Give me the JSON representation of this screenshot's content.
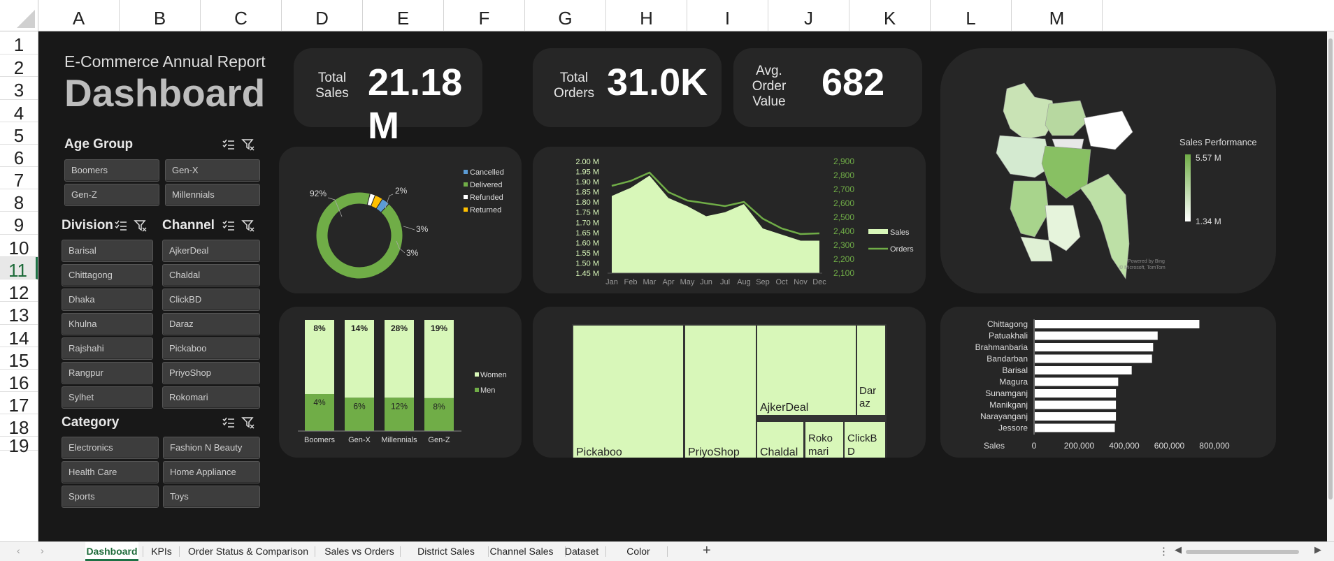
{
  "columns": [
    "A",
    "B",
    "C",
    "D",
    "E",
    "F",
    "G",
    "H",
    "I",
    "J",
    "K",
    "L",
    "M"
  ],
  "rows": [
    "1",
    "2",
    "3",
    "4",
    "5",
    "6",
    "7",
    "8",
    "9",
    "10",
    "11",
    "12",
    "13",
    "14",
    "15",
    "16",
    "17",
    "18",
    "19"
  ],
  "selected_row": "11",
  "header": {
    "subtitle": "E-Commerce Annual Report",
    "title": "Dashboard"
  },
  "kpis": [
    {
      "label": "Total\nSales",
      "value": "21.18 M"
    },
    {
      "label": "Total\nOrders",
      "value": "31.0K"
    },
    {
      "label": "Avg.\nOrder\nValue",
      "value": "682"
    }
  ],
  "slicers": {
    "age_group": {
      "title": "Age Group",
      "items": [
        "Boomers",
        "Gen-X",
        "Gen-Z",
        "Millennials"
      ]
    },
    "division": {
      "title": "Division",
      "items": [
        "Barisal",
        "Chittagong",
        "Dhaka",
        "Khulna",
        "Rajshahi",
        "Rangpur",
        "Sylhet"
      ]
    },
    "channel": {
      "title": "Channel",
      "items": [
        "AjkerDeal",
        "Chaldal",
        "ClickBD",
        "Daraz",
        "Pickaboo",
        "PriyoShop",
        "Rokomari"
      ]
    },
    "category": {
      "title": "Category",
      "items": [
        "Electronics",
        "Fashion N Beauty",
        "Health Care",
        "Home Appliance",
        "Sports",
        "Toys"
      ]
    }
  },
  "colors": {
    "green": "#70ad47",
    "light_green": "#d8f7b9",
    "blue": "#5b9bd5",
    "orange": "#ffc000",
    "card": "#262626",
    "bg": "#181818"
  },
  "chart_data": [
    {
      "type": "pie",
      "subtype": "donut",
      "legend": [
        "Cancelled",
        "Delivered",
        "Refunded",
        "Returned"
      ],
      "values": [
        3,
        92,
        2,
        3
      ],
      "data_labels": [
        "3%",
        "92%",
        "2%",
        "3%"
      ],
      "colors": [
        "#5b9bd5",
        "#70ad47",
        "#ffffff",
        "#ffc000"
      ]
    },
    {
      "type": "area",
      "categories": [
        "Jan",
        "Feb",
        "Mar",
        "Apr",
        "May",
        "Jun",
        "Jul",
        "Aug",
        "Sep",
        "Oct",
        "Nov",
        "Dec"
      ],
      "series": [
        {
          "name": "Sales",
          "axis": "left",
          "values": [
            1.83,
            1.87,
            1.93,
            1.82,
            1.78,
            1.73,
            1.75,
            1.79,
            1.67,
            1.64,
            1.61,
            1.61
          ]
        },
        {
          "name": "Orders",
          "axis": "right",
          "values": [
            2725,
            2760,
            2820,
            2680,
            2620,
            2600,
            2580,
            2610,
            2490,
            2420,
            2380,
            2385
          ]
        }
      ],
      "y_ticks": [
        "2.00 M",
        "1.95 M",
        "1.90 M",
        "1.85 M",
        "1.80 M",
        "1.75 M",
        "1.70 M",
        "1.65 M",
        "1.60 M",
        "1.55 M",
        "1.50 M",
        "1.45 M"
      ],
      "y_range": [
        1.45,
        2.0
      ],
      "y2_ticks": [
        "2,900",
        "2,800",
        "2,700",
        "2,600",
        "2,500",
        "2,400",
        "2,300",
        "2,200",
        "2,100"
      ],
      "y2_range": [
        2100,
        2900
      ],
      "legend_position": "right"
    },
    {
      "type": "map",
      "title": "Sales Performance",
      "legend_max": "5.57 M",
      "legend_min": "1.34 M",
      "attribution_1": "Powered by Bing",
      "attribution_2": "© Microsoft, TomTom"
    },
    {
      "type": "bar",
      "subtype": "stacked_100",
      "categories": [
        "Boomers",
        "Gen-X",
        "Millennials",
        "Gen-Z"
      ],
      "series": [
        {
          "name": "Women",
          "values": [
            8,
            14,
            28,
            19
          ],
          "labels": [
            "8%",
            "14%",
            "28%",
            "19%"
          ]
        },
        {
          "name": "Men",
          "values": [
            4,
            6,
            12,
            8
          ],
          "labels": [
            "4%",
            "6%",
            "12%",
            "8%"
          ]
        }
      ],
      "legend_position": "right"
    },
    {
      "type": "treemap",
      "items": [
        {
          "label": "Pickaboo"
        },
        {
          "label": "PriyoShop"
        },
        {
          "label": "AjkerDeal"
        },
        {
          "label": "Daraz"
        },
        {
          "label": "Chaldal"
        },
        {
          "label": "Rokomari"
        },
        {
          "label": "ClickBD"
        }
      ]
    },
    {
      "type": "bar",
      "orientation": "horizontal",
      "categories": [
        "Chittagong",
        "Patuakhali",
        "Brahmanbaria",
        "Bandarban",
        "Barisal",
        "Magura",
        "Sunamganj",
        "Manikganj",
        "Narayanganj",
        "Jessore"
      ],
      "values": [
        730000,
        545000,
        525000,
        520000,
        430000,
        370000,
        360000,
        360000,
        360000,
        355000
      ],
      "x_ticks": [
        "0",
        "200,000",
        "400,000",
        "600,000",
        "800,000"
      ],
      "xlim": [
        0,
        800000
      ],
      "xlabel": "Sales"
    }
  ],
  "sheet_tabs": [
    "Dashboard",
    "KPIs",
    "Order Status & Comparison",
    "Sales vs Orders",
    "District Sales",
    "Channel Sales",
    "Dataset",
    "Color Code"
  ],
  "active_tab": "Dashboard",
  "add_sheet_label": "+"
}
